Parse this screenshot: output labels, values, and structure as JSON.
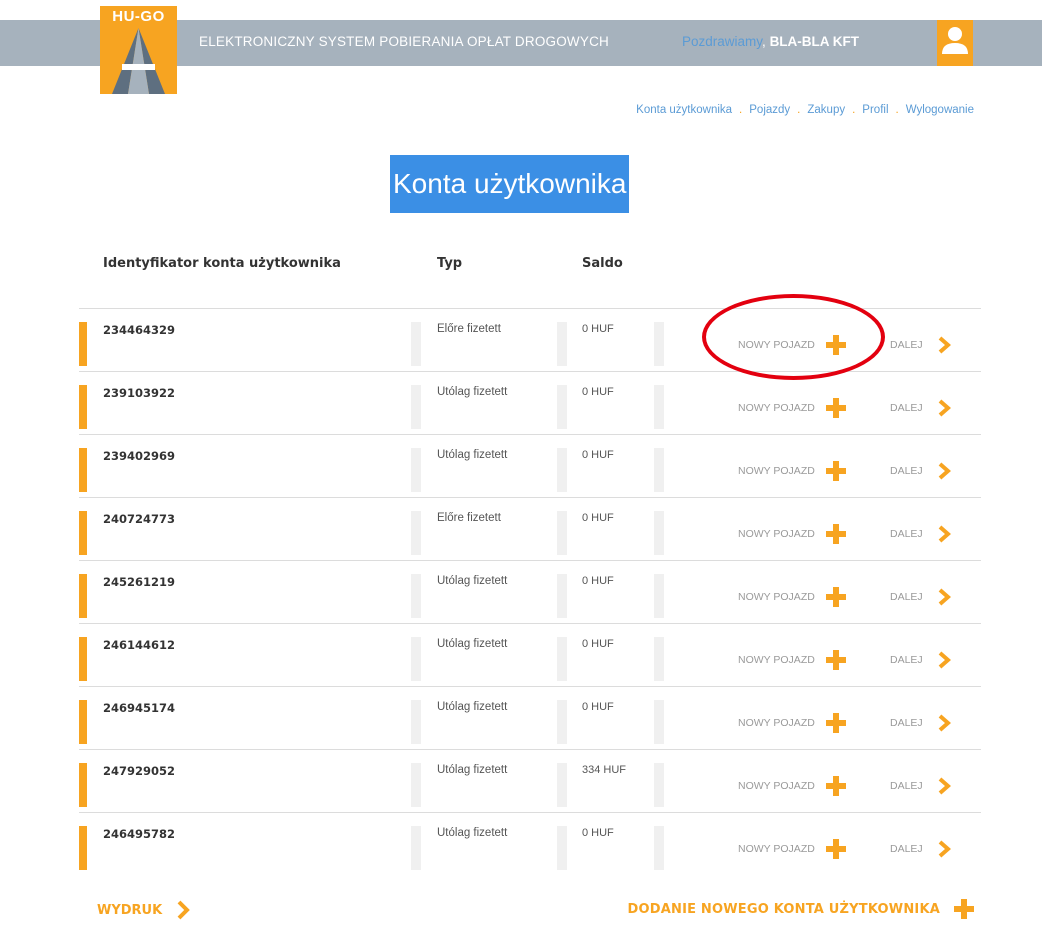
{
  "header": {
    "logo_text": "HU-GO",
    "system_title": "ELEKTRONICZNY SYSTEM POBIERANIA OPŁAT DROGOWYCH",
    "greeting": "Pozdrawiamy",
    "greeting_separator": ",",
    "company": "BLA-BLA KFT",
    "user_icon": "user-icon",
    "accent_color": "#f7a421",
    "bar_color": "#a6b2bd"
  },
  "nav": {
    "items": [
      {
        "label": "Konta użytkownika"
      },
      {
        "label": "Pojazdy"
      },
      {
        "label": "Zakupy"
      },
      {
        "label": "Profil"
      },
      {
        "label": "Wylogowanie"
      }
    ],
    "separator": "."
  },
  "page": {
    "title": "Konta użytkownika"
  },
  "table": {
    "columns": [
      "Identyfikator konta użytkownika",
      "Typ",
      "Saldo"
    ],
    "new_vehicle_label": "NOWY POJAZD",
    "next_label": "DALEJ",
    "rows": [
      {
        "id": "234464329",
        "type": "Előre fizetett",
        "balance": "0 HUF"
      },
      {
        "id": "239103922",
        "type": "Utólag fizetett",
        "balance": "0 HUF"
      },
      {
        "id": "239402969",
        "type": "Utólag fizetett",
        "balance": "0 HUF"
      },
      {
        "id": "240724773",
        "type": "Előre fizetett",
        "balance": "0 HUF"
      },
      {
        "id": "245261219",
        "type": "Utólag fizetett",
        "balance": "0 HUF"
      },
      {
        "id": "246144612",
        "type": "Utólag fizetett",
        "balance": "0 HUF"
      },
      {
        "id": "246945174",
        "type": "Utólag fizetett",
        "balance": "0 HUF"
      },
      {
        "id": "247929052",
        "type": "Utólag fizetett",
        "balance": "334 HUF"
      },
      {
        "id": "246495782",
        "type": "Utólag fizetett",
        "balance": "0 HUF"
      }
    ]
  },
  "footer": {
    "print_label": "WYDRUK",
    "add_account_label": "DODANIE NOWEGO KONTA UŻYTKOWNIKA"
  },
  "annotation": {
    "highlight_color": "#e3000f"
  }
}
